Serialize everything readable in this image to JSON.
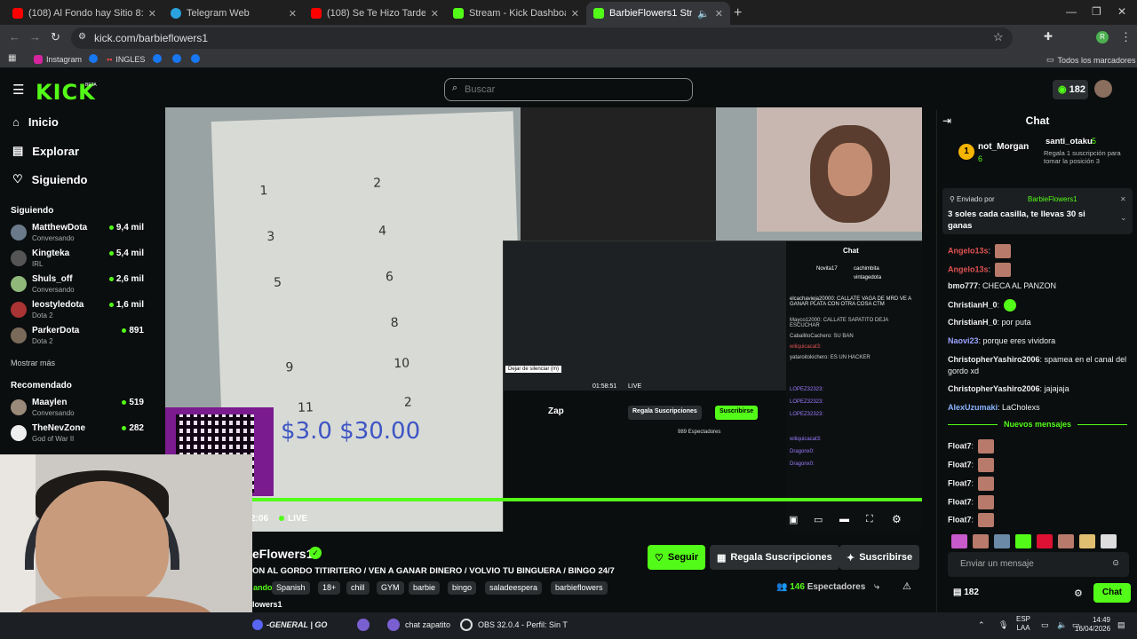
{
  "browser": {
    "tabs": [
      {
        "label": "(108) Al Fondo hay Sitio 8: Ferna",
        "color": "#ff0000"
      },
      {
        "label": "Telegram Web",
        "color": "#2aa3df"
      },
      {
        "label": "(108) Se Te Hizo Tarde (feat. Ele",
        "color": "#ff0000"
      },
      {
        "label": "Stream - Kick Dashboard",
        "color": "#53fc18"
      },
      {
        "label": "BarbieFlowers1 Stream - W",
        "color": "#53fc18"
      }
    ],
    "url": "kick.com/barbieflowers1",
    "bookmarks": [
      "Instagram",
      "INGLES"
    ],
    "all_bookmarks": "Todos los marcadores",
    "profile_initial": "R"
  },
  "kick": {
    "logo": "KICK",
    "logo_badge": "BETA",
    "search_placeholder": "Buscar",
    "points": "182",
    "nav": [
      {
        "label": "Inicio",
        "icon": "home-icon"
      },
      {
        "label": "Explorar",
        "icon": "compass-icon"
      },
      {
        "label": "Siguiendo",
        "icon": "heart-icon"
      }
    ],
    "following_title": "Siguiendo",
    "following": [
      {
        "name": "MatthewDota",
        "sub": "Conversando",
        "viewers": "9,4 mil"
      },
      {
        "name": "Kingteka",
        "sub": "IRL",
        "viewers": "5,4 mil"
      },
      {
        "name": "Shuls_off",
        "sub": "Conversando",
        "viewers": "2,6 mil"
      },
      {
        "name": "leostyledota",
        "sub": "Dota 2",
        "viewers": "1,6 mil"
      },
      {
        "name": "ParkerDota",
        "sub": "Dota 2",
        "viewers": "891"
      }
    ],
    "show_more": "Mostrar más",
    "recommended_title": "Recomendado",
    "recommended": [
      {
        "name": "Maaylen",
        "sub": "Conversando",
        "viewers": "519"
      },
      {
        "name": "TheNevZone",
        "sub": "God of War II",
        "viewers": "282"
      }
    ]
  },
  "video": {
    "paper_numbers": [
      "1",
      "2",
      "3",
      "4",
      "5",
      "6",
      "8",
      "9",
      "10",
      "11",
      "2"
    ],
    "handwritten": "$3.0   $30.00",
    "timer": "2:06",
    "live": "LIVE",
    "nested": {
      "chat_title": "Chat",
      "tooltip": "Dejar de silenciar (m)",
      "time": "01:58:51",
      "live": "LIVE",
      "gift_btn": "Regala Suscripciones",
      "sub_btn": "Suscribirse",
      "viewers": "989 Espectadores",
      "streamer": "Zap",
      "top_users": [
        "Novita17",
        "cachimbita",
        "vintagedota"
      ],
      "messages": [
        "elcachavieja20000: CALLATE VAGA DE MRD VE A GANAR PLATA CON OTRA COSA CTM",
        "Mayco12000: CALLATE SAPATITO DEJA ESCUCHAR",
        "CaballitoCachero: SU BAN",
        "wiliquicacat3:",
        "yataroitokichero: ES UN HACKER",
        "LOPEZ32323:",
        "LOPEZ32323:",
        "LOPEZ32323:",
        "wiliquicacat3:",
        "Dragonx0:",
        "Dragonx0:"
      ]
    }
  },
  "stream": {
    "name": "eFlowers1",
    "title": "ON AL GORDO TITIRITERO / VEN A GANAR DINERO / VOLVIO TU BINGUERA / BINGO 24/7",
    "tags": [
      "ando",
      "Spanish",
      "18+",
      "chill",
      "GYM",
      "barbie",
      "bingo",
      "saladeespera",
      "barbieflowers"
    ],
    "extra_tag": "lowers1",
    "follow": "Seguir",
    "gift": "Regala Suscripciones",
    "subscribe": "Suscribirse",
    "viewers": "146",
    "viewers_label": "Espectadores"
  },
  "chat": {
    "title": "Chat",
    "top": [
      {
        "name": "not_Morgan",
        "rank": "1",
        "count": "6"
      },
      {
        "name": "santi_otaku",
        "count": "5",
        "note": "Regala 1 suscripción para tomar la posición 3"
      }
    ],
    "pinned_by": "Enviado por",
    "pinned_user": "BarbieFlowers1",
    "pinned_text": "3 soles cada casilla, te llevas 30 si ganas",
    "messages": [
      {
        "user": "Angelo13s",
        "text": "",
        "color": "#e05252",
        "emote": true
      },
      {
        "user": "Angelo13s",
        "text": "",
        "color": "#e05252",
        "emote": true
      },
      {
        "user": "bmo777",
        "text": "CHECA AL PANZON",
        "color": "#ffffff"
      },
      {
        "user": "ChristianH_0",
        "text": "",
        "color": "#ffffff",
        "emote": true
      },
      {
        "user": "ChristianH_0",
        "text": "por puta",
        "color": "#ffffff"
      },
      {
        "user": "Naovi23",
        "text": "porque eres vividora",
        "color": "#9aa4ff"
      },
      {
        "user": "ChristopherYashiro2006",
        "text": "spamea en el canal del gordo xd",
        "color": "#ffffff"
      },
      {
        "user": "ChristopherYashiro2006",
        "text": "jajajaja",
        "color": "#ffffff"
      },
      {
        "user": "AlexUzumaki",
        "text": "LaCholexs",
        "color": "#8ab4ff"
      }
    ],
    "new_messages": "Nuevos mensajes",
    "new": [
      {
        "user": "Float7"
      },
      {
        "user": "Float7"
      },
      {
        "user": "Float7"
      },
      {
        "user": "Float7"
      },
      {
        "user": "Float7"
      }
    ],
    "input_placeholder": "Enviar un mensaje",
    "coins": "182",
    "send": "Chat"
  },
  "taskbar": {
    "items": [
      "-GENERAL | GO",
      "chat zapatito",
      "OBS 32.0.4 - Perfil: Sin T"
    ],
    "lang": "ESP",
    "lang2": "LAA",
    "time": "14:49",
    "date": "16/04/2026"
  }
}
